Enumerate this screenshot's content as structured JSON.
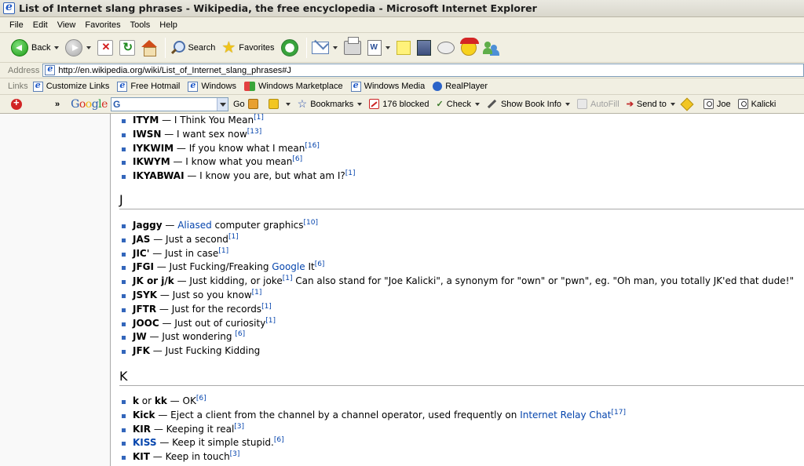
{
  "window": {
    "title": "List of Internet slang phrases - Wikipedia, the free encyclopedia - Microsoft Internet Explorer"
  },
  "menu": [
    "File",
    "Edit",
    "View",
    "Favorites",
    "Tools",
    "Help"
  ],
  "toolbar": {
    "back_label": "Back",
    "search_label": "Search",
    "favorites_label": "Favorites"
  },
  "address": {
    "label": "Address",
    "url": "http://en.wikipedia.org/wiki/List_of_Internet_slang_phrases#J"
  },
  "links": {
    "label": "Links",
    "items": [
      "Customize Links",
      "Free Hotmail",
      "Windows",
      "Windows Marketplace",
      "Windows Media",
      "RealPlayer"
    ]
  },
  "google_toolbar": {
    "chevrons": "»",
    "logo": "Google",
    "search_value": "G",
    "go_label": "Go",
    "bookmarks_label": "Bookmarks",
    "blocked_label": "176 blocked",
    "check_label": "Check",
    "show_book_info_label": "Show Book Info",
    "autofill_label": "AutoFill",
    "send_to_label": "Send to",
    "joe_label": "Joe",
    "kalicki_label": "Kalicki"
  },
  "article": {
    "i_items": [
      {
        "term": "ITYM",
        "sep": " — ",
        "def": "I Think You Mean",
        "ref": "[1]"
      },
      {
        "term": "IWSN",
        "sep": " — ",
        "def": "I want sex now",
        "ref": "[13]"
      },
      {
        "term": "IYKWIM",
        "sep": " — ",
        "def": "If you know what I mean",
        "ref": "[16]"
      },
      {
        "term": "IKWYM",
        "sep": " — ",
        "def": "I know what you mean",
        "ref": "[6]"
      },
      {
        "term": "IKYABWAI",
        "sep": " — ",
        "def": "I know you are, but what am I?",
        "ref": "[1]"
      }
    ],
    "heading_j": "J",
    "j_items": {
      "jaggy": {
        "term": "Jaggy",
        "sep": " — ",
        "link": "Aliased",
        "def": " computer graphics",
        "ref": "[10]"
      },
      "jas": {
        "term": "JAS",
        "sep": " — ",
        "def": "Just a second",
        "ref": "[1]"
      },
      "jic": {
        "term": "JIC'",
        "sep": " — ",
        "def": "Just in case",
        "ref": "[1]"
      },
      "jfgi": {
        "term": "JFGI",
        "sep": " — ",
        "def": "Just Fucking/Freaking ",
        "link": "Google",
        "def2": " It",
        "ref": "[6]"
      },
      "jk": {
        "term": "JK or j/k",
        "sep": " — ",
        "def": "Just kidding, or joke",
        "ref": "[1]",
        "def2": " Can also stand for \"Joe Kalicki\", a synonym for \"own\" or \"pwn\", eg. \"Oh man, you totally JK'ed that dude!\""
      },
      "jsyk": {
        "term": "JSYK",
        "sep": " — ",
        "def": "Just so you know",
        "ref": "[1]"
      },
      "jftr": {
        "term": "JFTR",
        "sep": " — ",
        "def": "Just for the records",
        "ref": "[1]"
      },
      "jooc": {
        "term": "JOOC",
        "sep": " — ",
        "def": "Just out of curiosity",
        "ref": "[1]"
      },
      "jw": {
        "term": "JW",
        "sep": " — ",
        "def": "Just wondering ",
        "ref": "[6]"
      },
      "jfk": {
        "term": "JFK",
        "sep": " — ",
        "def": "Just Fucking Kidding",
        "ref": ""
      }
    },
    "heading_k": "K",
    "k_items": {
      "k": {
        "term1": "k",
        "mid": " or ",
        "term2": "kk",
        "sep": " — ",
        "def": "OK",
        "ref": "[6]"
      },
      "kick": {
        "term": "Kick",
        "sep": " — ",
        "def": "Eject a client from the channel by a channel operator, used frequently on ",
        "link": "Internet Relay Chat",
        "ref": "[17]"
      },
      "kir": {
        "term": "KIR",
        "sep": " — ",
        "def": "Keeping it real",
        "ref": "[3]"
      },
      "kiss": {
        "term": "KISS",
        "sep": " — ",
        "def": "Keep it simple stupid.",
        "ref": "[6]"
      },
      "kit": {
        "term": "KIT",
        "sep": " — ",
        "def": "Keep in touch",
        "ref": "[3]"
      }
    }
  },
  "colors": {
    "link": "#0645ad",
    "chrome": "#f1efe2",
    "bullet": "#3366bb"
  }
}
